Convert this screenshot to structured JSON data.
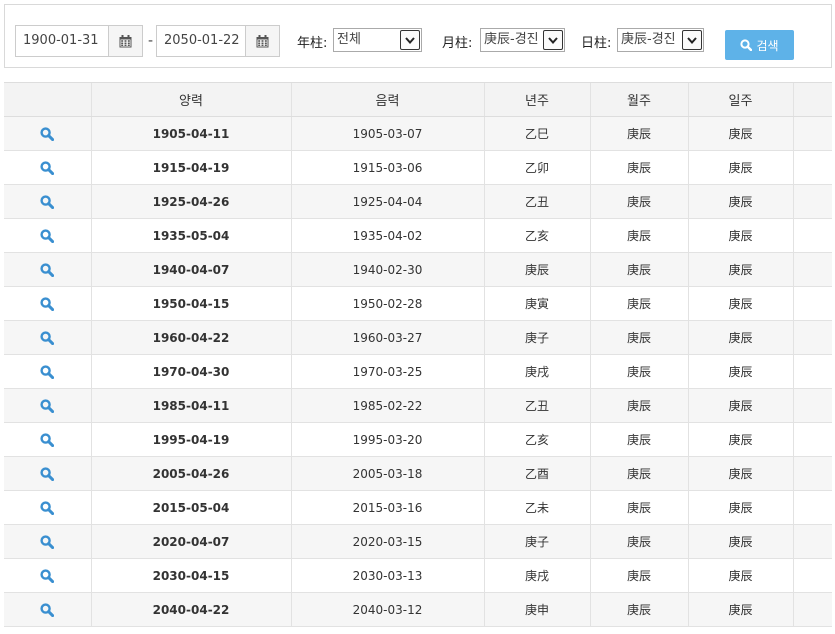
{
  "filters": {
    "start_date": "1900-01-31",
    "end_date": "2050-01-22",
    "range_separator": "-",
    "year_label": "年柱:",
    "year_value": "전체",
    "month_label": "月柱:",
    "month_value": "庚辰-경진",
    "day_label": "日柱:",
    "day_value": "庚辰-경진",
    "search_label": "검색"
  },
  "table": {
    "columns": [
      "",
      "양력",
      "음력",
      "년주",
      "월주",
      "일주",
      ""
    ],
    "rows": [
      {
        "solar": "1905-04-11",
        "lunar": "1905-03-07",
        "year": "乙巳",
        "month": "庚辰",
        "day": "庚辰"
      },
      {
        "solar": "1915-04-19",
        "lunar": "1915-03-06",
        "year": "乙卯",
        "month": "庚辰",
        "day": "庚辰"
      },
      {
        "solar": "1925-04-26",
        "lunar": "1925-04-04",
        "year": "乙丑",
        "month": "庚辰",
        "day": "庚辰"
      },
      {
        "solar": "1935-05-04",
        "lunar": "1935-04-02",
        "year": "乙亥",
        "month": "庚辰",
        "day": "庚辰"
      },
      {
        "solar": "1940-04-07",
        "lunar": "1940-02-30",
        "year": "庚辰",
        "month": "庚辰",
        "day": "庚辰"
      },
      {
        "solar": "1950-04-15",
        "lunar": "1950-02-28",
        "year": "庚寅",
        "month": "庚辰",
        "day": "庚辰"
      },
      {
        "solar": "1960-04-22",
        "lunar": "1960-03-27",
        "year": "庚子",
        "month": "庚辰",
        "day": "庚辰"
      },
      {
        "solar": "1970-04-30",
        "lunar": "1970-03-25",
        "year": "庚戌",
        "month": "庚辰",
        "day": "庚辰"
      },
      {
        "solar": "1985-04-11",
        "lunar": "1985-02-22",
        "year": "乙丑",
        "month": "庚辰",
        "day": "庚辰"
      },
      {
        "solar": "1995-04-19",
        "lunar": "1995-03-20",
        "year": "乙亥",
        "month": "庚辰",
        "day": "庚辰"
      },
      {
        "solar": "2005-04-26",
        "lunar": "2005-03-18",
        "year": "乙酉",
        "month": "庚辰",
        "day": "庚辰"
      },
      {
        "solar": "2015-05-04",
        "lunar": "2015-03-16",
        "year": "乙未",
        "month": "庚辰",
        "day": "庚辰"
      },
      {
        "solar": "2020-04-07",
        "lunar": "2020-03-15",
        "year": "庚子",
        "month": "庚辰",
        "day": "庚辰"
      },
      {
        "solar": "2030-04-15",
        "lunar": "2030-03-13",
        "year": "庚戌",
        "month": "庚辰",
        "day": "庚辰"
      },
      {
        "solar": "2040-04-22",
        "lunar": "2040-03-12",
        "year": "庚申",
        "month": "庚辰",
        "day": "庚辰"
      }
    ]
  },
  "icons": {
    "calendar": "calendar-icon",
    "dropdown": "chevron-down-icon",
    "row_action": "search-icon"
  },
  "colors": {
    "accent": "#5eb2e8",
    "row_icon": "#3a8fd0",
    "header_bg": "#f3f3f3",
    "stripe_bg": "#f6f6f6"
  }
}
